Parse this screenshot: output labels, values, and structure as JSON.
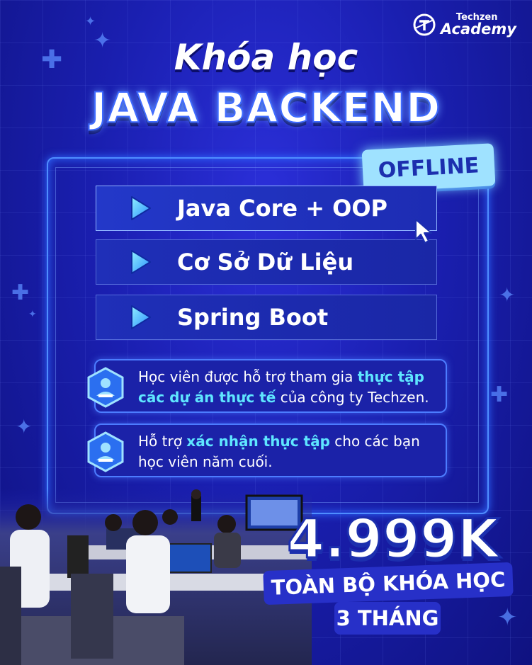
{
  "brand": {
    "line1": "Techzen",
    "line2": "Academy"
  },
  "heading": {
    "pre": "Khóa học",
    "title": "JAVA BACKEND"
  },
  "badge": "OFFLINE",
  "modules": [
    {
      "label": "Java Core + OOP"
    },
    {
      "label": "Cơ Sở Dữ Liệu"
    },
    {
      "label": "Spring Boot"
    }
  ],
  "info": [
    {
      "a": "Học viên được hỗ trợ tham gia ",
      "b": "thực tập các dự án thực tế",
      "c": " của công ty Techzen."
    },
    {
      "a": "Hỗ trợ ",
      "b": "xác nhận thực tập",
      "c": " cho các bạn học viên năm cuối."
    }
  ],
  "price": {
    "amount": "4.999K",
    "scope": "TOÀN BỘ KHÓA HỌC",
    "duration": "3 THÁNG"
  },
  "colors": {
    "background": "#1a1fb0",
    "accent": "#5fe6ff",
    "badge": "#9fe2ff",
    "border": "#4f8dff"
  }
}
